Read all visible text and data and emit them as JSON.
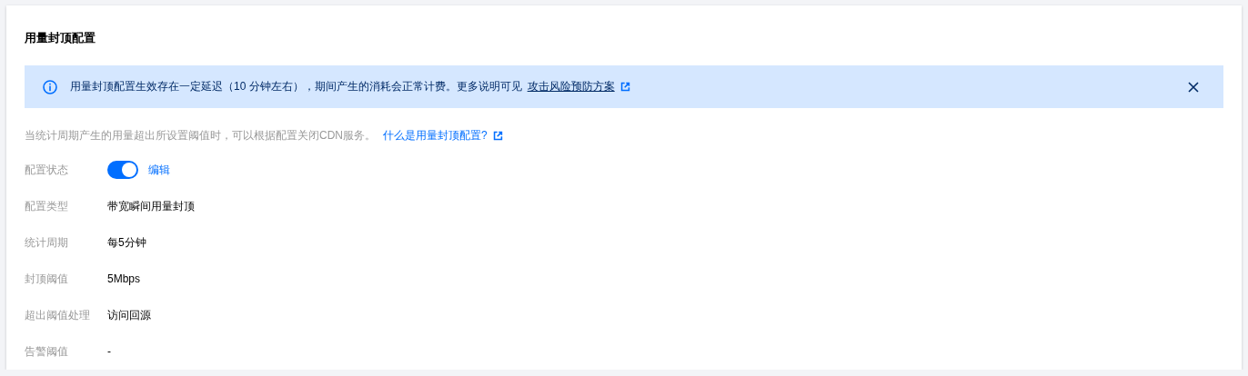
{
  "title": "用量封顶配置",
  "notice": {
    "text": "用量封顶配置生效存在一定延迟（10 分钟左右），期间产生的消耗会正常计费。更多说明可见",
    "link": "攻击风险预防方案"
  },
  "description": {
    "text": "当统计周期产生的用量超出所设置阈值时，可以根据配置关闭CDN服务。",
    "link": "什么是用量封顶配置?"
  },
  "fields": [
    {
      "kind": "toggle",
      "label": "配置状态",
      "on": true,
      "action": "编辑"
    },
    {
      "kind": "text",
      "label": "配置类型",
      "value": "带宽瞬间用量封顶"
    },
    {
      "kind": "text",
      "label": "统计周期",
      "value": "每5分钟"
    },
    {
      "kind": "text",
      "label": "封顶阈值",
      "value": "5Mbps"
    },
    {
      "kind": "text",
      "label": "超出阈值处理",
      "value": "访问回源"
    },
    {
      "kind": "text",
      "label": "告警阈值",
      "value": "-"
    }
  ]
}
